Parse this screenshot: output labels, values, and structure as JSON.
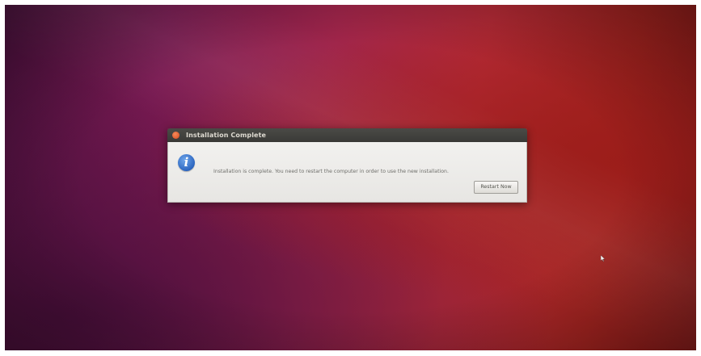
{
  "desktop": {
    "wallpaper_colors": [
      "#4f1140",
      "#a0254a",
      "#b42a36",
      "#8c1b19"
    ]
  },
  "dialog": {
    "title": "Installation Complete",
    "icon": "info-icon",
    "message": "Installation is complete. You need to restart the computer in order to use the new installation.",
    "restart_button_label": "Restart Now",
    "accent_close": "#d9491d",
    "icon_color": "#2d66c0"
  },
  "cursor": {
    "icon": "mouse-pointer-icon"
  }
}
